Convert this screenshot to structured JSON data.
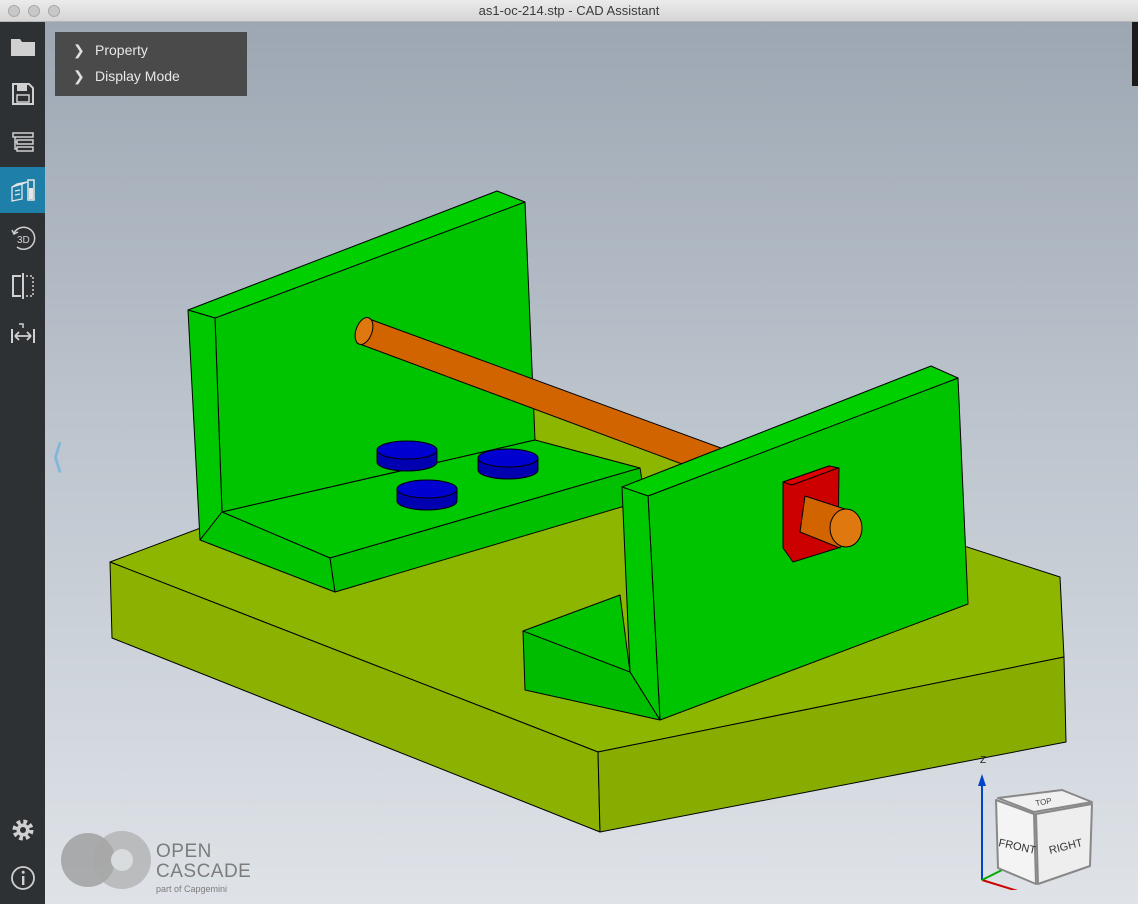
{
  "window": {
    "title": "as1-oc-214.stp - CAD Assistant"
  },
  "sidebar": {
    "items": [
      {
        "name": "open",
        "icon": "folder-icon"
      },
      {
        "name": "save",
        "icon": "save-icon"
      },
      {
        "name": "model-tree",
        "icon": "tree-icon"
      },
      {
        "name": "view-settings",
        "icon": "view-settings-icon",
        "active": true
      },
      {
        "name": "3d-view",
        "icon": "3d-icon",
        "label": "3D"
      },
      {
        "name": "clipping",
        "icon": "clipping-icon"
      },
      {
        "name": "measure",
        "icon": "measure-icon"
      }
    ],
    "bottom": [
      {
        "name": "settings",
        "icon": "gear-icon"
      },
      {
        "name": "about",
        "icon": "info-icon"
      }
    ]
  },
  "panel": {
    "items": [
      {
        "label": "Property"
      },
      {
        "label": "Display Mode"
      }
    ]
  },
  "viewcube": {
    "top": "TOP",
    "front": "FRONT",
    "right": "RIGHT",
    "axis_z": "Z",
    "axis_x": "X"
  },
  "logo": {
    "line1": "OPEN",
    "line2": "CASCADE",
    "line3": "part of Capgemini"
  },
  "colors": {
    "base_plate": "#8db600",
    "brackets": "#00cc00",
    "shaft": "#d2691e",
    "pucks": "#0000cc",
    "flange": "#cc0000",
    "sidebar_active": "#1e7fa8"
  }
}
